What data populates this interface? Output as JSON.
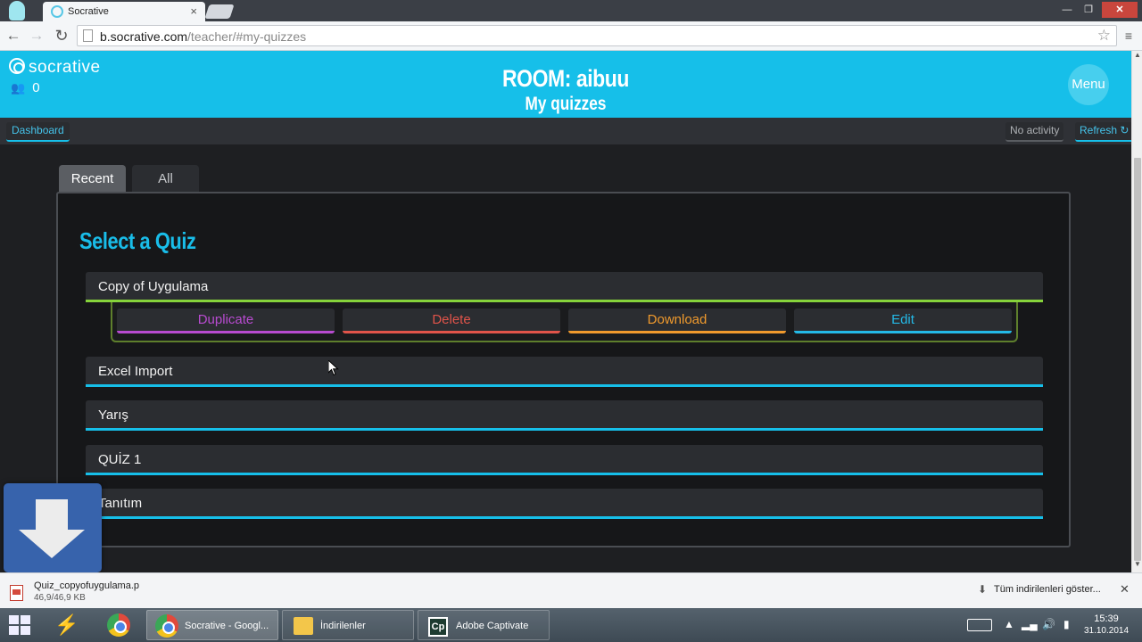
{
  "browser": {
    "tab_title": "Socrative",
    "tab_close": "×",
    "window_min": "—",
    "window_max": "❐",
    "window_close": "✕",
    "url_host": "b.socrative.com",
    "url_path": "/teacher/#my-quizzes",
    "menu_glyph": "≡"
  },
  "header": {
    "logo_text": "socrative",
    "students_count": "0",
    "room_title": "ROOM: aibuu",
    "room_subtitle": "My quizzes",
    "menu_label": "Menu ⋮",
    "accent_color": "#16bfe9"
  },
  "subnav": {
    "dashboard": "Dashboard",
    "activity": "No activity",
    "refresh": "Refresh ↻"
  },
  "tabs": [
    "Recent",
    "All"
  ],
  "panel": {
    "heading": "Select a Quiz"
  },
  "quizzes": [
    {
      "title": "Copy of Uygulama"
    },
    {
      "title": "Excel Import"
    },
    {
      "title": "Yarış"
    },
    {
      "title": "QUİZ 1"
    },
    {
      "title": "Tanıtım"
    }
  ],
  "actions": {
    "duplicate": "Duplicate",
    "delete": "Delete",
    "download": "Download",
    "edit": "Edit"
  },
  "downloads": {
    "file_name": "Quiz_copyofuygulama.p",
    "file_size": "46,9/46,9 KB",
    "show_all": "Tüm indirilenleri göster...",
    "close": "✕"
  },
  "taskbar": {
    "items": [
      {
        "label": "Socrative - Googl..."
      },
      {
        "label": "İndirilenler"
      },
      {
        "label": "Adobe Captivate"
      }
    ],
    "captivate_icon": "Cp",
    "time": "15:39",
    "date": "31.10.2014"
  }
}
